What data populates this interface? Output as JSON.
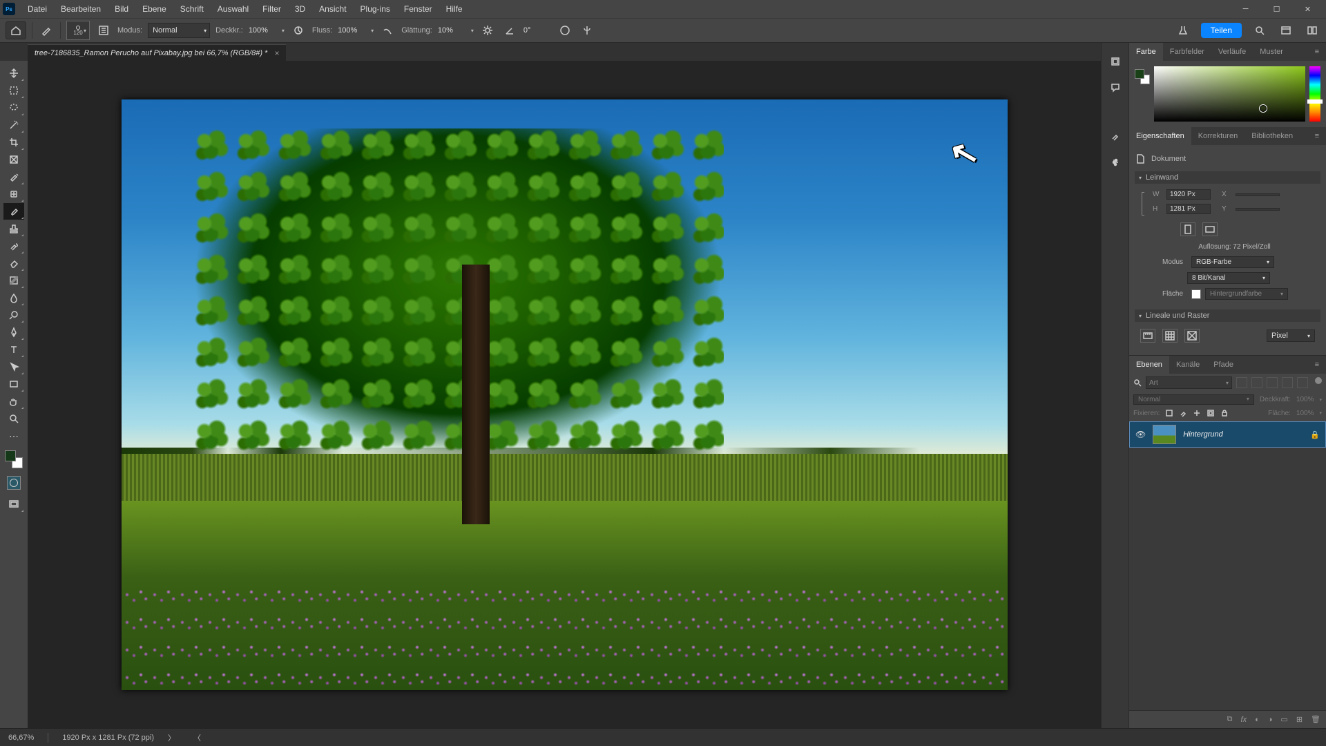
{
  "menu": [
    "Datei",
    "Bearbeiten",
    "Bild",
    "Ebene",
    "Schrift",
    "Auswahl",
    "Filter",
    "3D",
    "Ansicht",
    "Plug-ins",
    "Fenster",
    "Hilfe"
  ],
  "options": {
    "brush_size": "120",
    "mode_label": "Modus:",
    "mode_value": "Normal",
    "opacity_label": "Deckkr.:",
    "opacity_value": "100%",
    "flow_label": "Fluss:",
    "flow_value": "100%",
    "smooth_label": "Glättung:",
    "smooth_value": "10%",
    "angle_value": "0°",
    "share": "Teilen"
  },
  "doc_tab": "tree-7186835_Ramon Perucho auf Pixabay.jpg bei 66,7% (RGB/8#) *",
  "color_tabs": [
    "Farbe",
    "Farbfelder",
    "Verläufe",
    "Muster"
  ],
  "props_tabs": [
    "Eigenschaften",
    "Korrekturen",
    "Bibliotheken"
  ],
  "props": {
    "doc": "Dokument",
    "canvas_hdr": "Leinwand",
    "W": "W",
    "W_val": "1920 Px",
    "X": "X",
    "H": "H",
    "H_val": "1281 Px",
    "Y": "Y",
    "res": "Auflösung: 72 Pixel/Zoll",
    "mode_lbl": "Modus",
    "mode_val": "RGB-Farbe",
    "depth": "8 Bit/Kanal",
    "fill_lbl": "Fläche",
    "fill_val": "Hintergrundfarbe",
    "rulers_hdr": "Lineale und Raster",
    "unit": "Pixel"
  },
  "layers_tabs": [
    "Ebenen",
    "Kanäle",
    "Pfade"
  ],
  "layers": {
    "search_ph": "Art",
    "blend": "Normal",
    "opacity_lbl": "Deckkraft:",
    "opacity_val": "100%",
    "lock_lbl": "Fixieren:",
    "fill_lbl": "Fläche:",
    "fill_val": "100%",
    "bg_layer": "Hintergrund"
  },
  "status": {
    "zoom": "66,67%",
    "dims": "1920 Px x 1281 Px (72 ppi)"
  }
}
